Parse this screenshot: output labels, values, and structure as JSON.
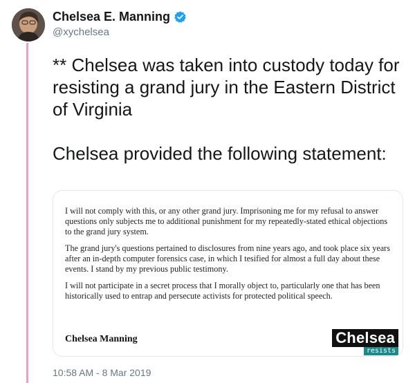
{
  "colors": {
    "thread_line": "#f19ec2",
    "verified": "#1da1f2",
    "muted": "#657786",
    "logo_accent": "#1a8a8a"
  },
  "author": {
    "display_name": "Chelsea E. Manning",
    "handle": "@xychelsea",
    "verified_icon": "verified-badge-icon"
  },
  "tweet": {
    "line1": "** Chelsea was taken into custody today for resisting a grand jury in the Eastern District of Virginia",
    "line2": "Chelsea provided the following statement:"
  },
  "statement": {
    "paragraphs": [
      "I will not comply with this, or any other grand jury. Imprisoning me for my refusal to answer questions only subjects me to additional punishment for my repeatedly-stated ethical objections to the grand jury system.",
      "The grand jury's questions pertained to disclosures from nine years ago, and took place six years after an in-depth computer forensics case, in which I tesified for almost a full day about these events. I stand by my previous public testimony.",
      "I will not participate in a secret process that I morally object to, particularly one that has been historically used to entrap and persecute activists for protected political speech."
    ],
    "signature": "Chelsea Manning",
    "logo_main": "Chelsea",
    "logo_sub": "resists"
  },
  "timestamp": "10:58 AM - 8 Mar 2019"
}
